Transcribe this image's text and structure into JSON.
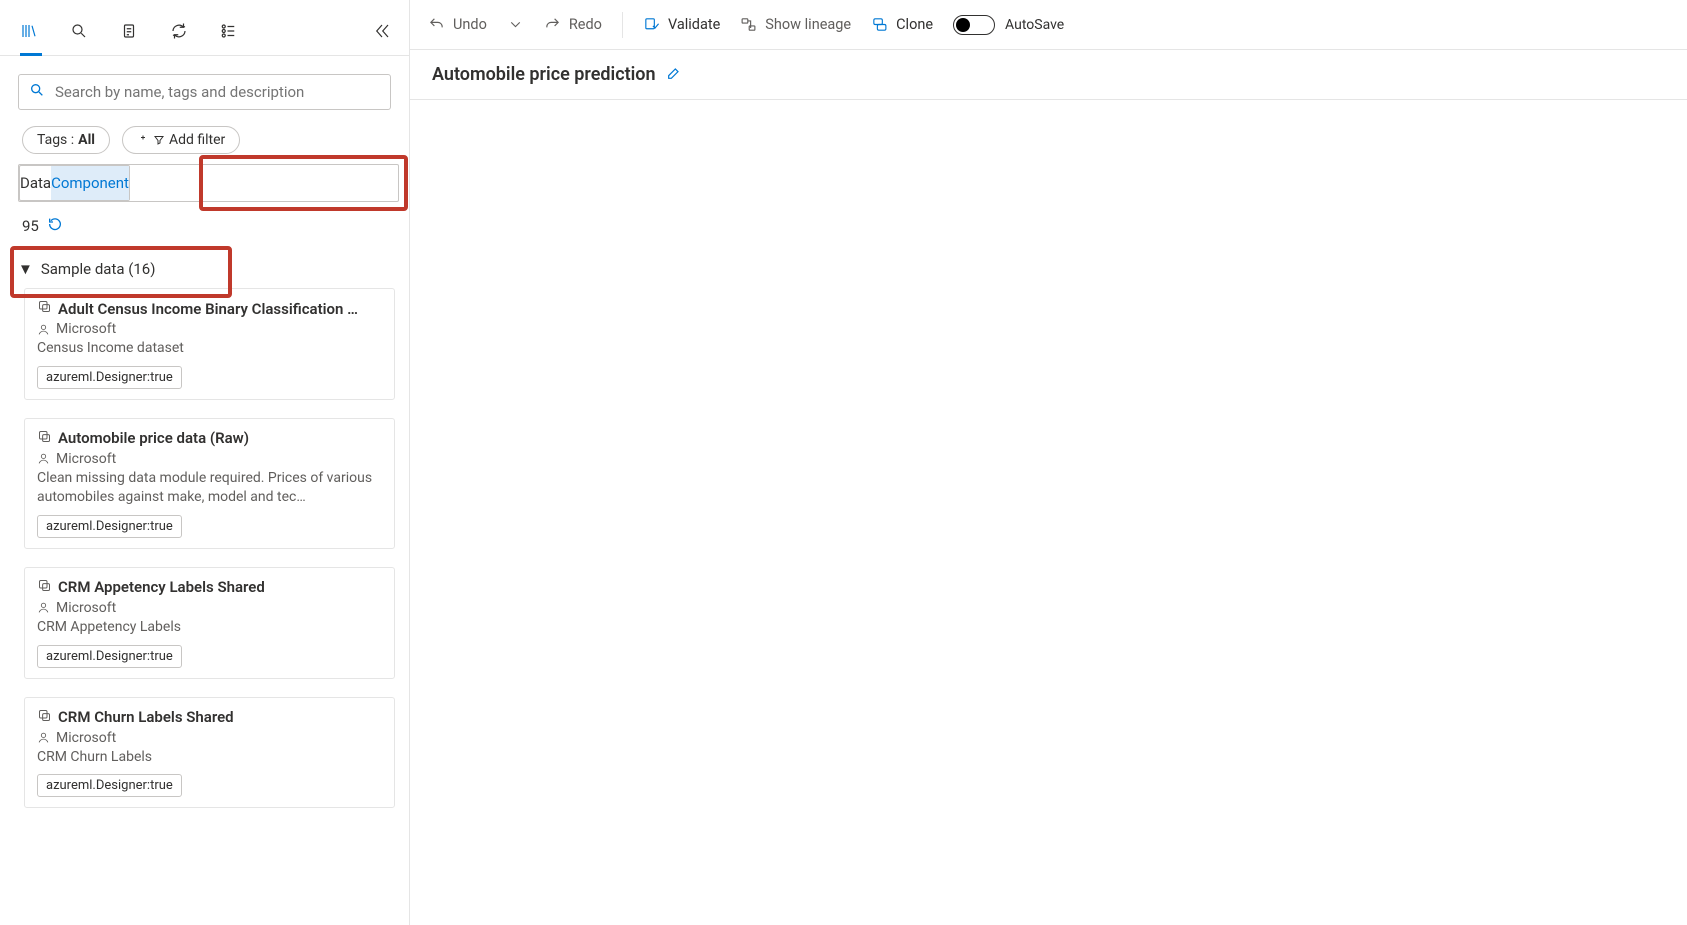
{
  "sidebar": {
    "search_placeholder": "Search by name, tags and description",
    "tags_label": "Tags :",
    "tags_value": "All",
    "add_filter_label": "Add filter",
    "tab_data": "Data",
    "tab_component": "Component",
    "result_count": "95",
    "category_label": "Sample data (16)"
  },
  "samples": [
    {
      "title": "Adult Census Income Binary Classification dat…",
      "owner": "Microsoft",
      "description": "Census Income dataset",
      "tag": "azureml.Designer:true"
    },
    {
      "title": "Automobile price data (Raw)",
      "owner": "Microsoft",
      "description": "Clean missing data module required. Prices of various automobiles against make, model and tec…",
      "tag": "azureml.Designer:true"
    },
    {
      "title": "CRM Appetency Labels Shared",
      "owner": "Microsoft",
      "description": "CRM Appetency Labels",
      "tag": "azureml.Designer:true"
    },
    {
      "title": "CRM Churn Labels Shared",
      "owner": "Microsoft",
      "description": "CRM Churn Labels",
      "tag": "azureml.Designer:true"
    }
  ],
  "toolbar": {
    "undo": "Undo",
    "redo": "Redo",
    "validate": "Validate",
    "show_lineage": "Show lineage",
    "clone": "Clone",
    "autosave": "AutoSave"
  },
  "pipeline_title": "Automobile price prediction"
}
